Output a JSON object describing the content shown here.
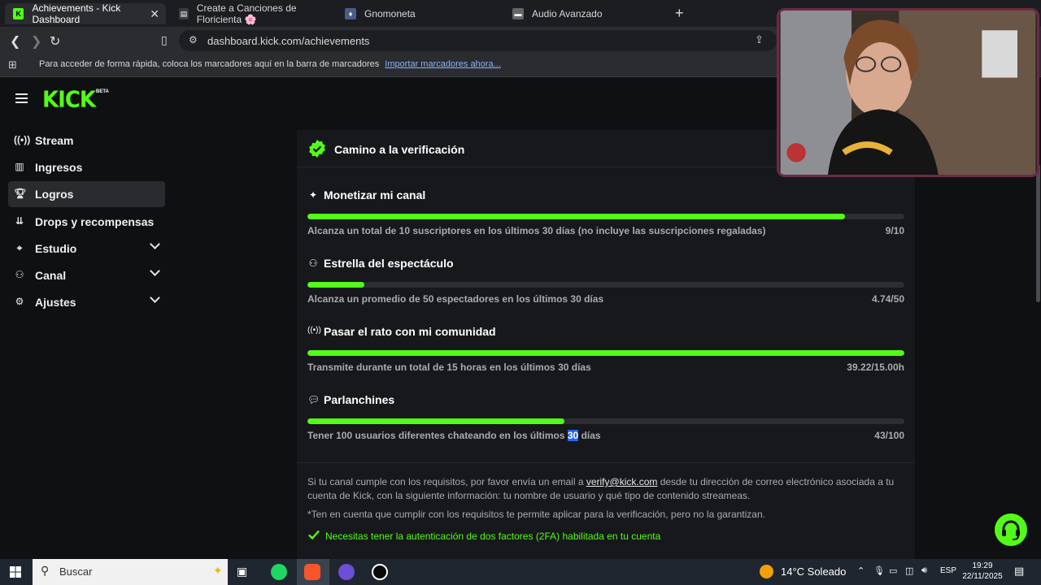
{
  "browser": {
    "tabs": [
      {
        "label": "Achievements - Kick Dashboard",
        "active": true
      },
      {
        "label": "Create a Canciones de Floricienta 🌸",
        "active": false
      },
      {
        "label": "Gnomoneta",
        "active": false
      },
      {
        "label": "Audio Avanzado",
        "active": false
      }
    ],
    "url": "dashboard.kick.com/achievements",
    "bookmarks_text": "Para acceder de forma rápida, coloca los marcadores aquí en la barra de marcadores",
    "bookmarks_link": "Importar marcadores ahora..."
  },
  "kick": {
    "logo": "KICK",
    "beta": "BETA",
    "accent": "#53fc18",
    "sidebar": [
      {
        "label": "Stream",
        "icon": "broadcast-icon",
        "expandable": false,
        "active": false
      },
      {
        "label": "Ingresos",
        "icon": "chart-icon",
        "expandable": false,
        "active": false
      },
      {
        "label": "Logros",
        "icon": "trophy-icon",
        "expandable": false,
        "active": true
      },
      {
        "label": "Drops y recompensas",
        "icon": "drops-icon",
        "expandable": false,
        "active": false
      },
      {
        "label": "Estudio",
        "icon": "studio-icon",
        "expandable": true,
        "active": false
      },
      {
        "label": "Canal",
        "icon": "channel-icon",
        "expandable": true,
        "active": false
      },
      {
        "label": "Ajustes",
        "icon": "gear-icon",
        "expandable": true,
        "active": false
      }
    ],
    "card": {
      "title": "Camino a la verificación",
      "goals": [
        {
          "title": "Monetizar mi canal",
          "icon": "sparkle-icon",
          "description": "Alcanza un total de 10 suscriptores en los últimos 30 días (no incluye las suscripciones regaladas)",
          "value": "9/10",
          "progress": 0.9
        },
        {
          "title": "Estrella del espectáculo",
          "icon": "users-icon",
          "description": "Alcanza un promedio de 50 espectadores en los últimos 30 días",
          "value": "4.74/50",
          "progress": 0.095
        },
        {
          "title": "Pasar el rato con mi comunidad",
          "icon": "broadcast-icon",
          "description": "Transmite durante un total de 15 horas en los últimos 30 días",
          "value": "39.22/15.00h",
          "progress": 1.0
        },
        {
          "title": "Parlanchines",
          "icon": "chat-icon",
          "description_before": "Tener 100 usuarios diferentes chateando en los últimos ",
          "description_highlight": "30",
          "description_after": " días",
          "value": "43/100",
          "progress": 0.43
        }
      ],
      "info_before_email": "Si tu canal cumple con los requisitos, por favor envía un email a ",
      "info_email": "verify@kick.com",
      "info_after_email": " desde tu dirección de correo electrónico asociada a tu cuenta de Kick, con la siguiente información: tu nombre de usuario y qué tipo de contenido streameas.",
      "note": "*Ten en cuenta que cumplir con los requisitos te permite aplicar para la verificación, pero no la garantizan.",
      "requirement": "Necesitas tener la autenticación de dos factores (2FA) habilitada en tu cuenta"
    }
  },
  "taskbar": {
    "search_placeholder": "Buscar",
    "weather": "14°C  Soleado",
    "language": "ESP",
    "time": "19:29",
    "date": "22/11/2025"
  }
}
